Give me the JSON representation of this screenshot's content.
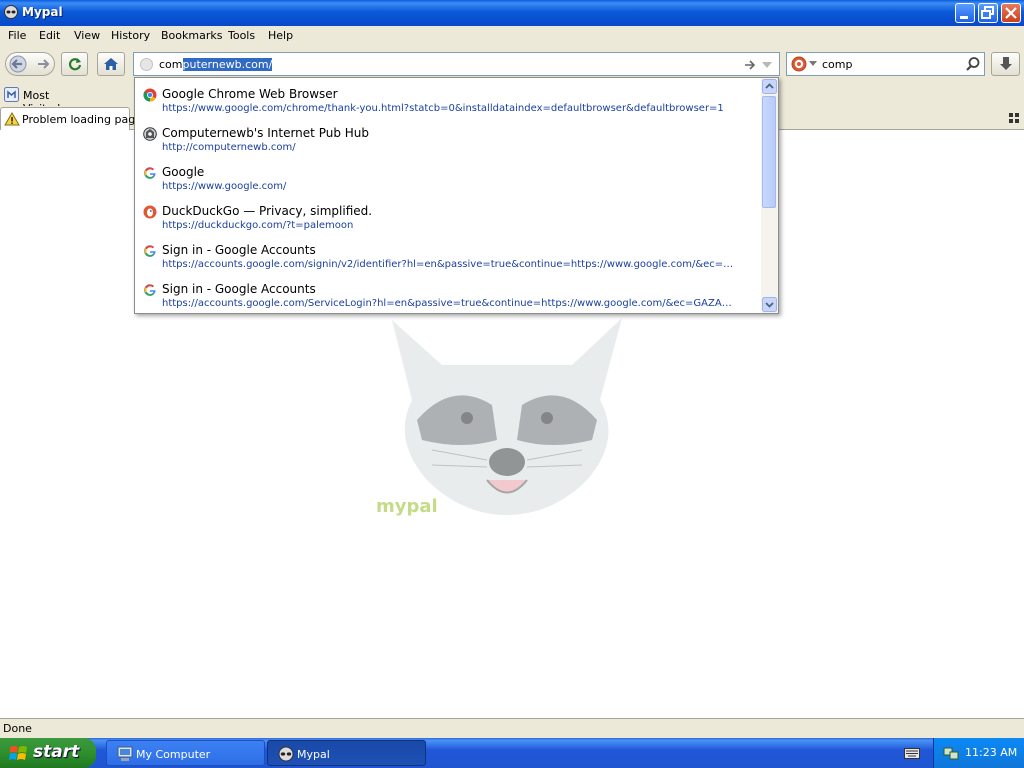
{
  "window": {
    "title": "Mypal"
  },
  "menu": [
    "File",
    "Edit",
    "View",
    "History",
    "Bookmarks",
    "Tools",
    "Help"
  ],
  "url_bar": {
    "typed": "com",
    "autocompleted": "puternewb.com/"
  },
  "search_bar": {
    "value": "comp"
  },
  "bookmarks_toolbar": {
    "most_visited": "Most Visited"
  },
  "tab": {
    "label": "Problem loading page"
  },
  "suggestions": [
    {
      "title": "Google Chrome Web Browser",
      "url": "https://www.google.com/chrome/thank-you.html?statcb=0&installdataindex=defaultbrowser&defaultbrowser=1",
      "icon": "chrome-icon"
    },
    {
      "title": "Computernewb's Internet Pub Hub",
      "url": "http://computernewb.com/",
      "icon": "site-icon"
    },
    {
      "title": "Google",
      "url": "https://www.google.com/",
      "icon": "google-icon"
    },
    {
      "title": "DuckDuckGo — Privacy, simplified.",
      "url": "https://duckduckgo.com/?t=palemoon",
      "icon": "duckduckgo-icon"
    },
    {
      "title": "Sign in - Google Accounts",
      "url": "https://accounts.google.com/signin/v2/identifier?hl=en&passive=true&continue=https://www.google.com/&ec=GAZ...",
      "icon": "google-icon"
    },
    {
      "title": "Sign in - Google Accounts",
      "url": "https://accounts.google.com/ServiceLogin?hl=en&passive=true&continue=https://www.google.com/&ec=GAZAmgC...",
      "icon": "google-icon"
    }
  ],
  "content": {
    "watermark_text": "mypal"
  },
  "status": {
    "text": "Done"
  },
  "taskbar": {
    "start_label": "start",
    "items": [
      "My Computer",
      "Mypal"
    ],
    "clock": "11:23 AM"
  }
}
